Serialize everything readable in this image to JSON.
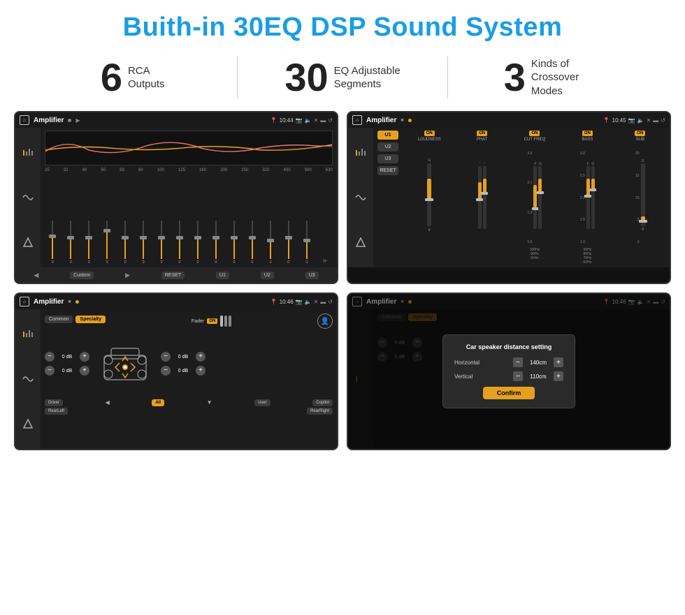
{
  "page": {
    "title": "Buith-in 30EQ DSP Sound System"
  },
  "stats": [
    {
      "number": "6",
      "label_line1": "RCA",
      "label_line2": "Outputs"
    },
    {
      "number": "30",
      "label_line1": "EQ Adjustable",
      "label_line2": "Segments"
    },
    {
      "number": "3",
      "label_line1": "Kinds of",
      "label_line2": "Crossover Modes"
    }
  ],
  "screens": [
    {
      "id": "eq-screen",
      "status_bar": {
        "app": "Amplifier",
        "time": "10:44"
      }
    },
    {
      "id": "crossover-screen",
      "status_bar": {
        "app": "Amplifier",
        "time": "10:45"
      }
    },
    {
      "id": "fader-screen",
      "status_bar": {
        "app": "Amplifier",
        "time": "10:46"
      }
    },
    {
      "id": "dialog-screen",
      "status_bar": {
        "app": "Amplifier",
        "time": "10:46"
      },
      "dialog": {
        "title": "Car speaker distance setting",
        "horizontal_label": "Horizontal",
        "horizontal_value": "140cm",
        "vertical_label": "Vertical",
        "vertical_value": "110cm",
        "confirm_btn": "Confirm"
      }
    }
  ],
  "eq": {
    "freq_labels": [
      "25",
      "32",
      "40",
      "50",
      "63",
      "80",
      "100",
      "125",
      "160",
      "200",
      "250",
      "320",
      "400",
      "500",
      "630"
    ],
    "values": [
      "0",
      "0",
      "0",
      "5",
      "0",
      "0",
      "0",
      "0",
      "0",
      "0",
      "0",
      "0",
      "-1",
      "0",
      "-1"
    ],
    "bottom_btns": [
      "Custom",
      "RESET",
      "U1",
      "U2",
      "U3"
    ]
  },
  "crossover": {
    "presets": [
      "U1",
      "U2",
      "U3"
    ],
    "channels": [
      {
        "label": "LOUDNESS",
        "on": true
      },
      {
        "label": "PHAT",
        "on": true
      },
      {
        "label": "CUT FREQ",
        "on": true
      },
      {
        "label": "BASS",
        "on": true
      },
      {
        "label": "SUB",
        "on": true
      }
    ]
  },
  "fader": {
    "tabs": [
      "Common",
      "Specialty"
    ],
    "db_values": [
      "0 dB",
      "0 dB",
      "0 dB",
      "0 dB"
    ],
    "fader_label": "Fader",
    "on_label": "ON",
    "bottom_btns": [
      "Driver",
      "Copilot",
      "RearLeft",
      "All",
      "User",
      "RearRight"
    ]
  },
  "dialog": {
    "title": "Car speaker distance setting",
    "horizontal_label": "Horizontal",
    "horizontal_value": "140cm",
    "vertical_label": "Vertical",
    "vertical_value": "110cm",
    "confirm_btn": "Confirm"
  }
}
